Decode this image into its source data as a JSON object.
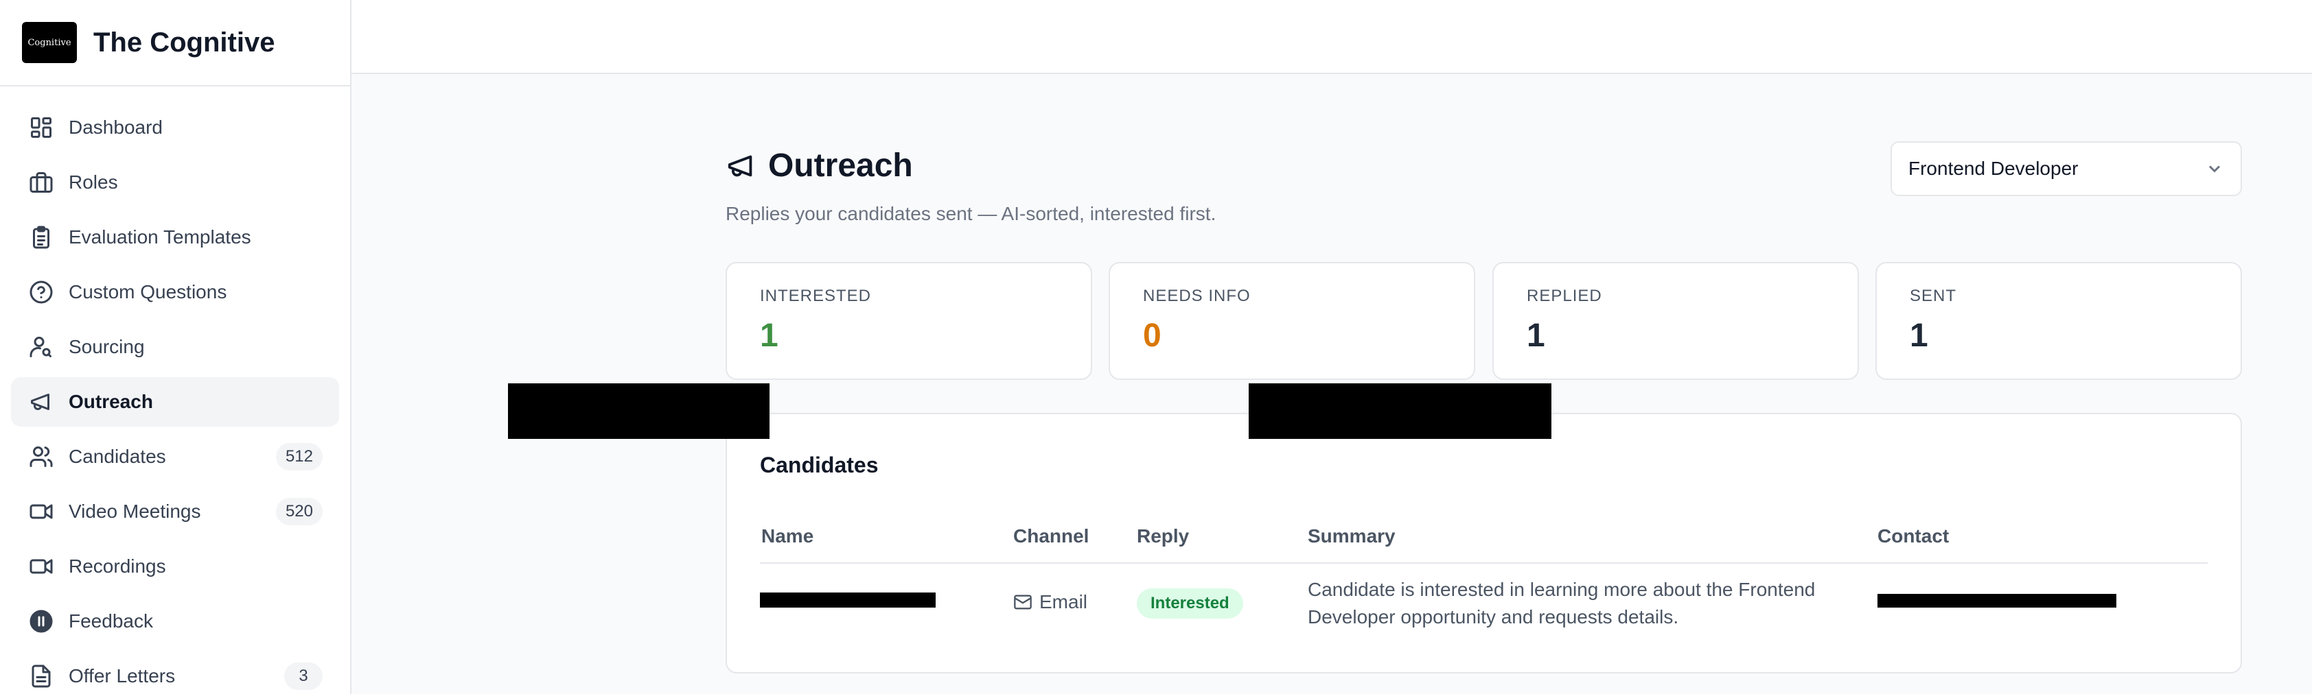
{
  "brand": {
    "logo_text": "Cognitive",
    "name": "The Cognitive"
  },
  "sidebar": {
    "items": [
      {
        "label": "Dashboard",
        "icon": "dashboard-icon"
      },
      {
        "label": "Roles",
        "icon": "briefcase-icon"
      },
      {
        "label": "Evaluation Templates",
        "icon": "clipboard-icon"
      },
      {
        "label": "Custom Questions",
        "icon": "help-circle-icon"
      },
      {
        "label": "Sourcing",
        "icon": "user-search-icon"
      },
      {
        "label": "Outreach",
        "icon": "megaphone-icon",
        "active": true
      },
      {
        "label": "Candidates",
        "icon": "users-icon",
        "count": "512"
      },
      {
        "label": "Video Meetings",
        "icon": "video-icon",
        "count": "520"
      },
      {
        "label": "Recordings",
        "icon": "video-icon"
      },
      {
        "label": "Feedback",
        "icon": "pause-circle-icon"
      },
      {
        "label": "Offer Letters",
        "icon": "file-text-icon",
        "count": "3"
      }
    ]
  },
  "page": {
    "title": "Outreach",
    "subtitle": "Replies your candidates sent — AI-sorted, interested first.",
    "role_select": "Frontend Developer"
  },
  "stats": [
    {
      "label": "INTERESTED",
      "value": "1",
      "color": "#3f9142"
    },
    {
      "label": "NEEDS INFO",
      "value": "0",
      "color": "#d97706"
    },
    {
      "label": "REPLIED",
      "value": "1",
      "color": "#1f2937"
    },
    {
      "label": "SENT",
      "value": "1",
      "color": "#1f2937"
    }
  ],
  "candidates": {
    "title": "Candidates",
    "columns": [
      "Name",
      "Channel",
      "Reply",
      "Summary",
      "Contact"
    ],
    "rows": [
      {
        "name": "",
        "channel": "Email",
        "reply": "Interested",
        "summary_line1": "Candidate is interested in learning more about the Frontend",
        "summary_line2": "Developer opportunity and requests details.",
        "contact": ""
      }
    ]
  }
}
